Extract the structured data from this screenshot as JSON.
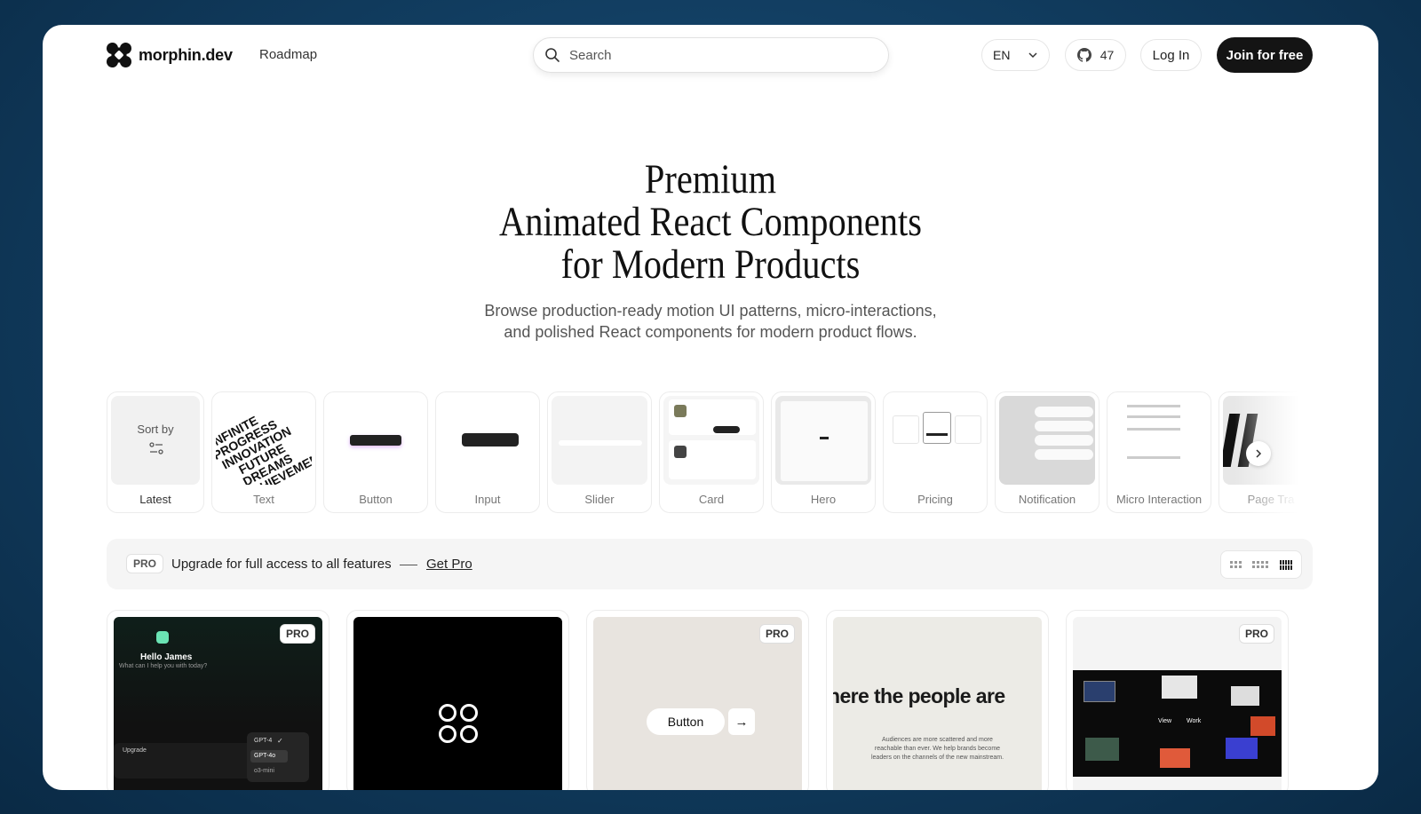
{
  "header": {
    "brand": "morphin.dev",
    "nav_roadmap": "Roadmap",
    "search_placeholder": "Search",
    "language": "EN",
    "github_stars": "47",
    "login_label": "Log In",
    "join_label": "Join for free"
  },
  "hero": {
    "title_line1": "Premium",
    "title_line2": "Animated React Components",
    "title_line3": "for Modern Products",
    "subtitle_line1": "Browse production-ready motion UI patterns, micro-interactions,",
    "subtitle_line2": "and polished React components for modern product flows."
  },
  "categories": {
    "sort_label": "Sort by",
    "items": [
      "Latest",
      "Text",
      "Button",
      "Input",
      "Slider",
      "Card",
      "Hero",
      "Pricing",
      "Notification",
      "Micro Interaction",
      "Page Tra"
    ]
  },
  "probar": {
    "badge": "PRO",
    "message": "Upgrade for full access to all features",
    "cta": "Get Pro"
  },
  "cards": {
    "card1": {
      "badge": "PRO",
      "greeting": "Hello James",
      "prompt": "What can I help you with today?",
      "upgrade": "Upgrade",
      "model1": "GPT-4",
      "model2": "GPT-4o",
      "model3": "o3-mini"
    },
    "card3": {
      "badge": "PRO",
      "button_label": "Button"
    },
    "card4": {
      "headline": "here the people are",
      "body_line1": "Audiences are more scattered and more",
      "body_line2": "reachable than ever. We help brands become",
      "body_line3": "leaders on the channels of the new mainstream."
    },
    "card5": {
      "badge": "PRO",
      "view": "View",
      "work": "Work"
    }
  },
  "colors": {
    "primary_button": "#141414",
    "background": "#123f63",
    "accent_green": "#6be3b4"
  }
}
